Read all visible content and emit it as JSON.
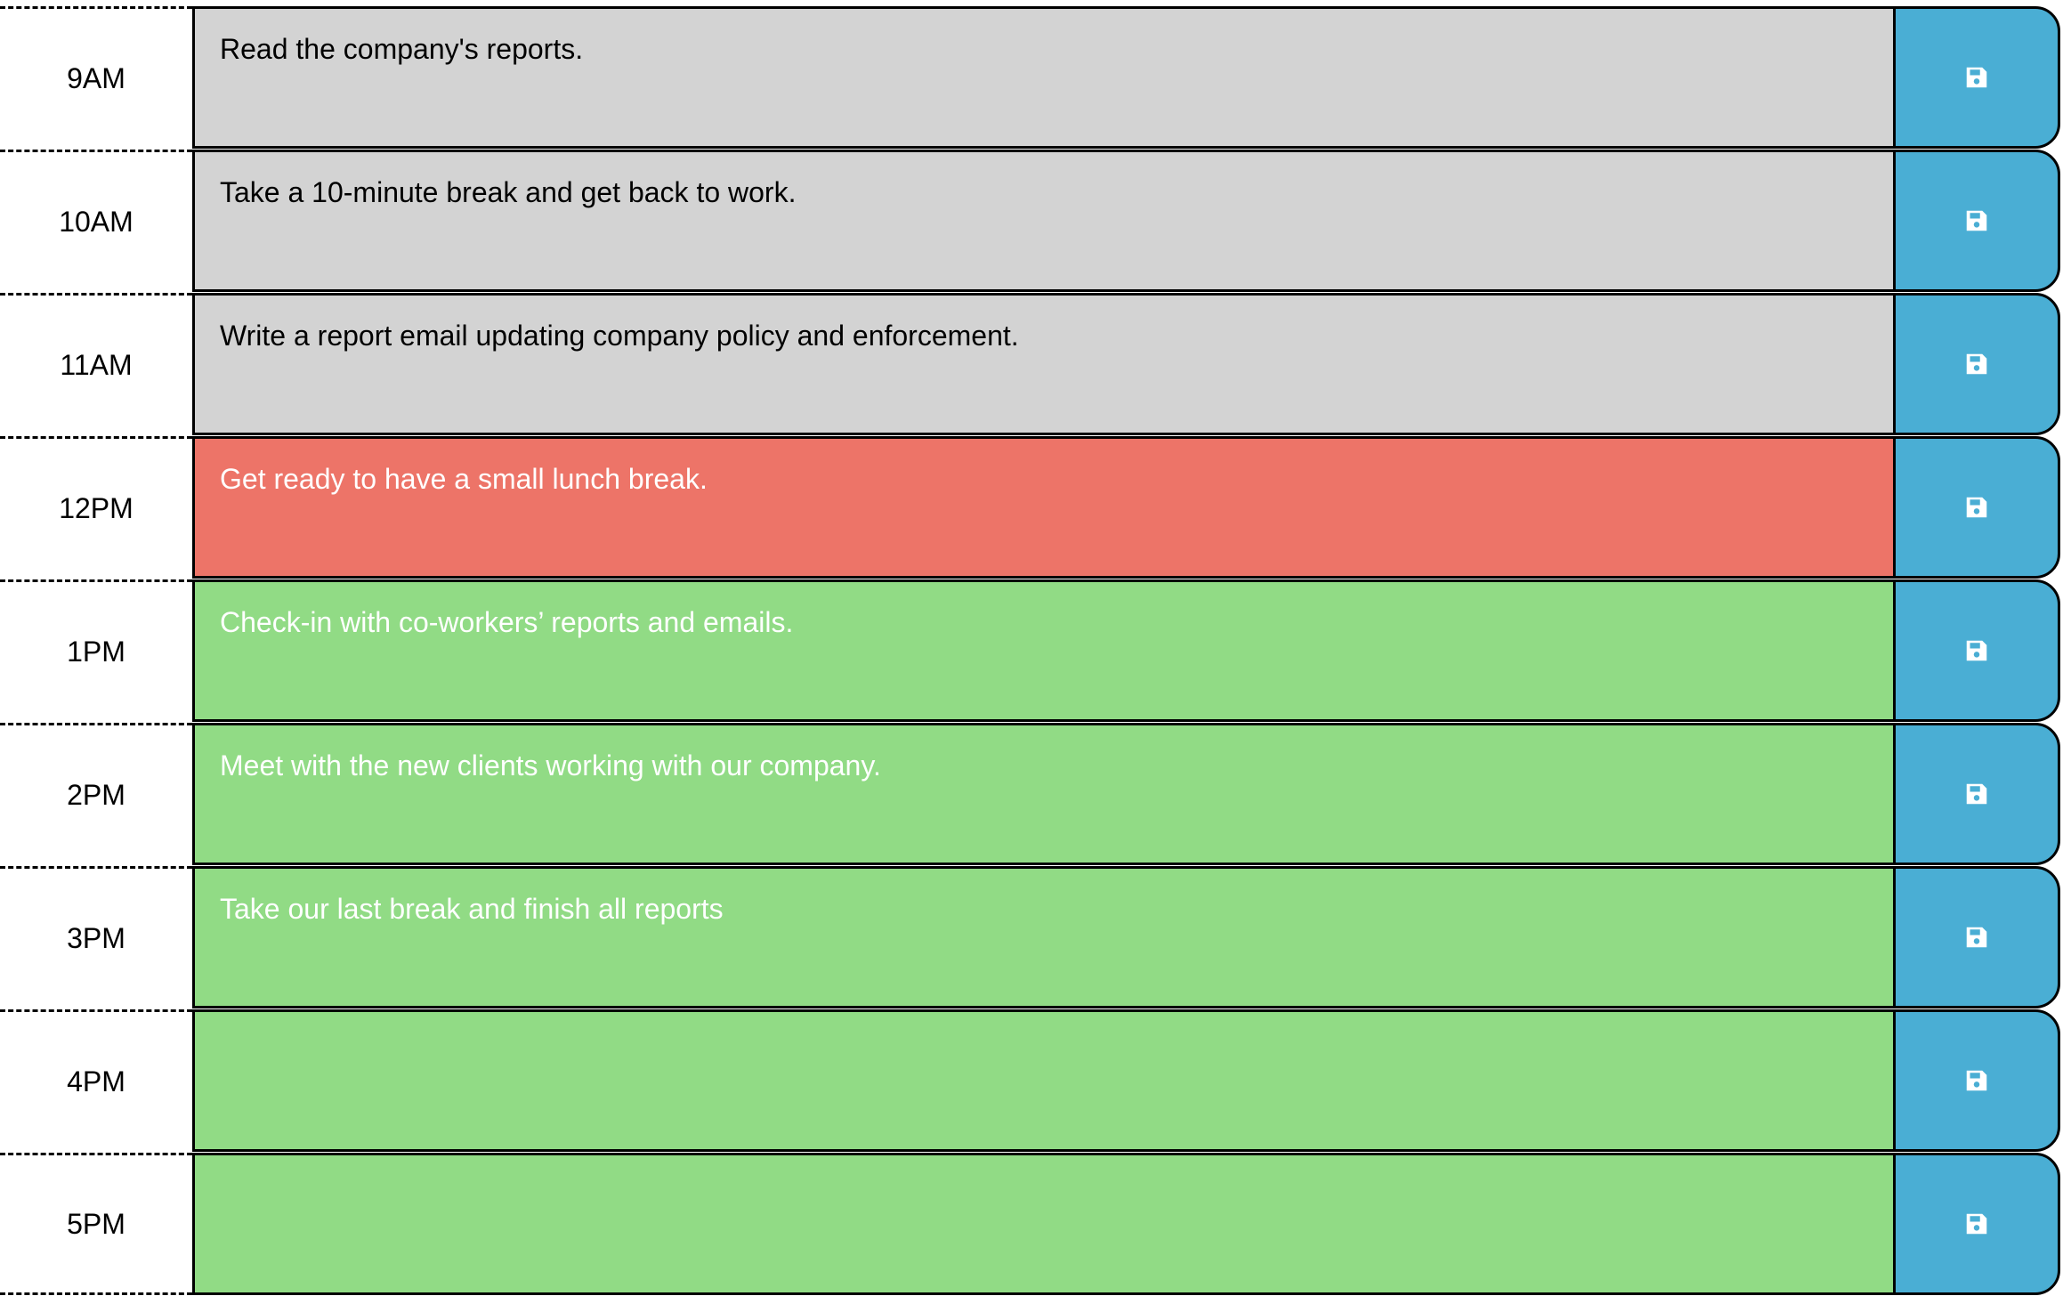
{
  "scheduler": {
    "colors": {
      "past": "#d3d3d3",
      "present": "#ed7468",
      "future": "#91db85",
      "save_button": "#4aaed4"
    },
    "save_icon": "save-icon",
    "blocks": [
      {
        "hour": "9AM",
        "text": "Read the company's reports.",
        "state": "past"
      },
      {
        "hour": "10AM",
        "text": "Take a 10-minute break and get back to work.",
        "state": "past"
      },
      {
        "hour": "11AM",
        "text": "Write a report email updating company policy and enforcement.",
        "state": "past"
      },
      {
        "hour": "12PM",
        "text": "Get ready to have a small lunch break.",
        "state": "present"
      },
      {
        "hour": "1PM",
        "text": "Check-in with co-workers’ reports and emails.",
        "state": "future"
      },
      {
        "hour": "2PM",
        "text": "Meet with the new clients working with our company.",
        "state": "future"
      },
      {
        "hour": "3PM",
        "text": "Take our last break and finish all reports",
        "state": "future"
      },
      {
        "hour": "4PM",
        "text": "",
        "state": "future"
      },
      {
        "hour": "5PM",
        "text": "",
        "state": "future"
      }
    ]
  }
}
